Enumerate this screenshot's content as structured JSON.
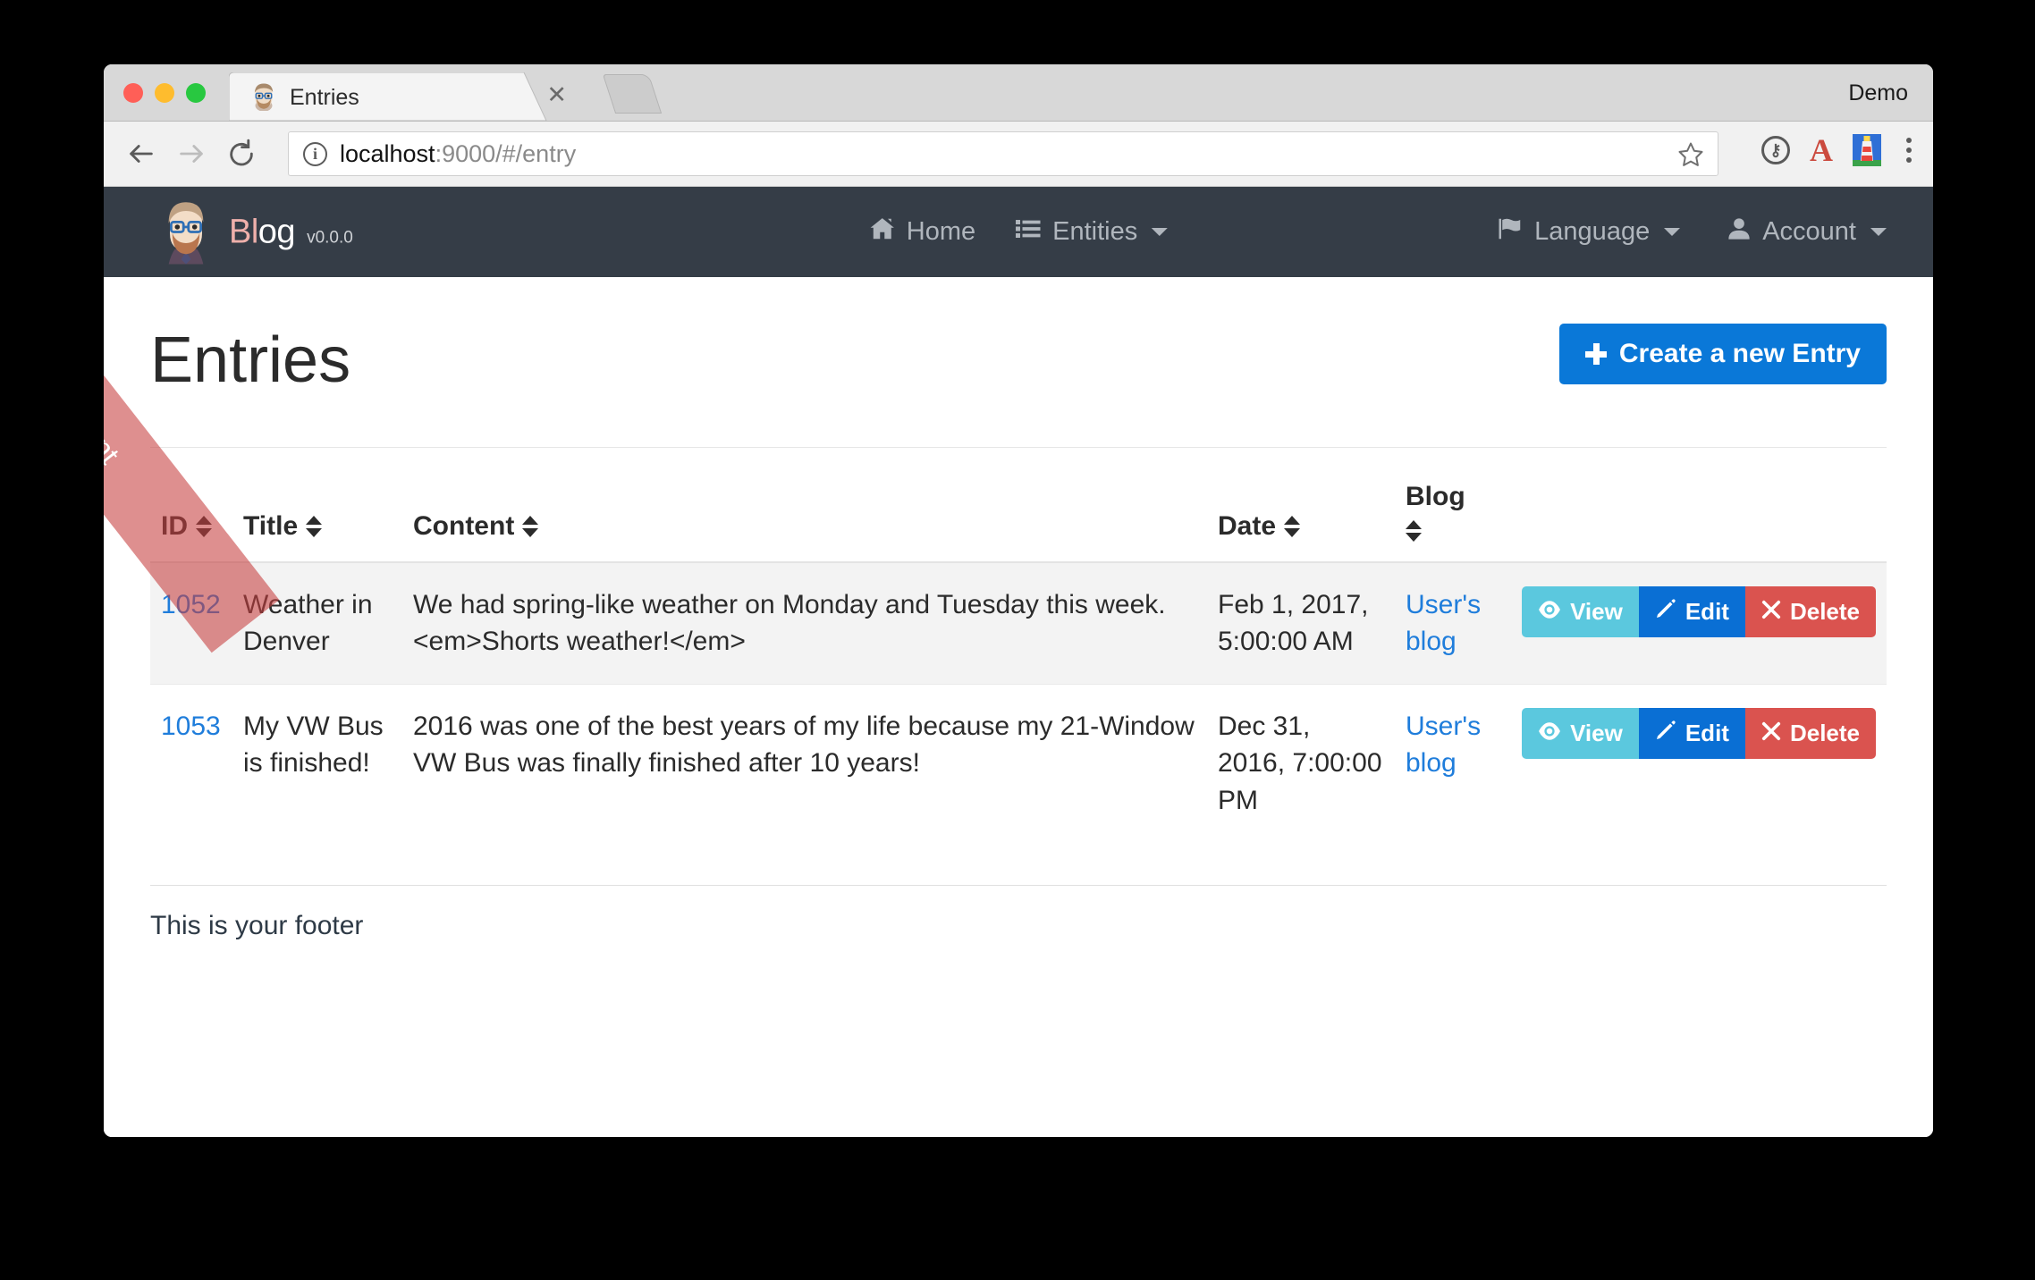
{
  "browser": {
    "tab": {
      "title": "Entries",
      "favicon_icon": "hipster-avatar-icon",
      "close_icon": "✕"
    },
    "new_tab_icon": "new-tab-icon",
    "profile_label": "Demo",
    "back_icon": "back-arrow-icon",
    "forward_icon": "forward-arrow-icon",
    "reload_icon": "reload-icon",
    "site_info_icon": "info-circle-icon",
    "url_host": "localhost",
    "url_rest": ":9000/#/entry",
    "bookmark_icon": "star-icon",
    "extensions": [
      "onepassword-icon",
      "adblock-a-icon",
      "lighthouse-icon",
      "chrome-menu-icon"
    ]
  },
  "ribbon": {
    "label": "Development",
    "color": "#c73e3e"
  },
  "navbar": {
    "brand": {
      "logo_icon": "hipster-avatar-logo",
      "name_highlight": "Bl",
      "name_rest": "og",
      "version": "v0.0.0"
    },
    "center_items": [
      {
        "label": "Home",
        "icon": "home-icon",
        "has_caret": false
      },
      {
        "label": "Entities",
        "icon": "list-icon",
        "has_caret": true
      }
    ],
    "right_items": [
      {
        "label": "Language",
        "icon": "flag-icon",
        "has_caret": true
      },
      {
        "label": "Account",
        "icon": "user-icon",
        "has_caret": true
      }
    ]
  },
  "page": {
    "title": "Entries",
    "create_button": {
      "label": "Create a new Entry",
      "icon": "plus-icon",
      "color": "#0a78d8"
    }
  },
  "table": {
    "columns": [
      {
        "label": "ID",
        "sortable": true
      },
      {
        "label": "Title",
        "sortable": true
      },
      {
        "label": "Content",
        "sortable": true
      },
      {
        "label": "Date",
        "sortable": true
      },
      {
        "label": "Blog",
        "sortable": true
      },
      {
        "label": "",
        "sortable": false
      }
    ],
    "rows": [
      {
        "id": "1052",
        "title": "Weather in Denver",
        "content": "We had spring-like weather on Monday and Tuesday this week. <em>Shorts weather!</em>",
        "date": "Feb 1, 2017, 5:00:00 AM",
        "blog": "User's blog",
        "actions": [
          {
            "label": "View",
            "icon": "eye-icon",
            "color": "#5bc8de"
          },
          {
            "label": "Edit",
            "icon": "pencil-icon",
            "color": "#0a6fd4"
          },
          {
            "label": "Delete",
            "icon": "x-icon",
            "color": "#da534f"
          }
        ]
      },
      {
        "id": "1053",
        "title": "My VW Bus is finished!",
        "content": "2016 was one of the best years of my life because my 21-Window VW Bus was finally finished after 10 years!",
        "date": "Dec 31, 2016, 7:00:00 PM",
        "blog": "User's blog",
        "actions": [
          {
            "label": "View",
            "icon": "eye-icon",
            "color": "#5bc8de"
          },
          {
            "label": "Edit",
            "icon": "pencil-icon",
            "color": "#0a6fd4"
          },
          {
            "label": "Delete",
            "icon": "x-icon",
            "color": "#da534f"
          }
        ]
      }
    ]
  },
  "footer": {
    "text": "This is your footer"
  }
}
